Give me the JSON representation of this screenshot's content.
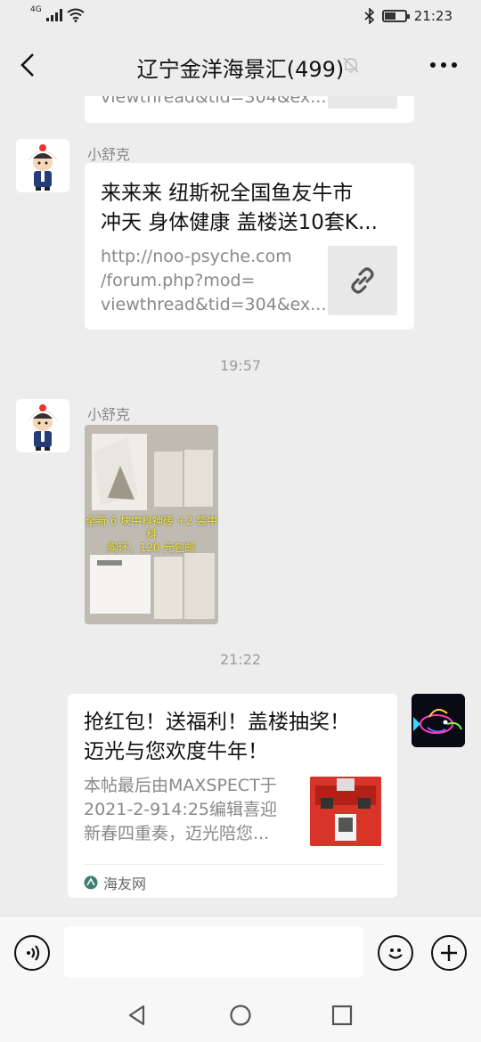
{
  "status": {
    "network": "4G",
    "time": "21:23",
    "battery_level": 0.5
  },
  "header": {
    "title": "辽宁金洋海景汇(499)"
  },
  "messages": {
    "prev_link": {
      "desc_tail": "viewthread&tid=304&ex..."
    },
    "msg1": {
      "sender": "小舒克",
      "title_line1": "来来来 纽斯祝全国鱼友牛市",
      "title_line2": "冲天 身体健康 盖楼送10套K...",
      "url_line1": "http://noo-psyche.com",
      "url_line2": "/forum.php?mod=",
      "url_line3": "viewthread&tid=304&ex..."
    },
    "time1": "19:57",
    "msg2": {
      "sender": "小舒克",
      "image_caption_line1": "全新 6 块中科神砖 +2 袋中科",
      "image_caption_line2": "陶环，120 元包邮"
    },
    "time2": "21:22",
    "msg3": {
      "title_line1": "抢红包！送福利！盖楼抽奖！",
      "title_line2": "迈光与您欢度牛年！",
      "desc_line1": "本帖最后由MAXSPECT于",
      "desc_line2": "2021-2-914:25编辑喜迎",
      "desc_line3": "新春四重奏，迈光陪您...",
      "source": "海友网"
    }
  },
  "input": {
    "placeholder": ""
  },
  "icons": {
    "back": "chevron-left-icon",
    "mute": "bell-off-icon",
    "more": "more-dots-icon",
    "link": "link-icon",
    "voice": "voice-icon",
    "emoji": "emoji-icon",
    "plus": "plus-icon",
    "source_logo": "haiyou-logo-icon",
    "sys_back": "triangle-back-icon",
    "sys_home": "circle-home-icon",
    "sys_recent": "square-recent-icon"
  },
  "colors": {
    "background": "#ededed",
    "bubble": "#ffffff",
    "muted_text": "#888888"
  }
}
